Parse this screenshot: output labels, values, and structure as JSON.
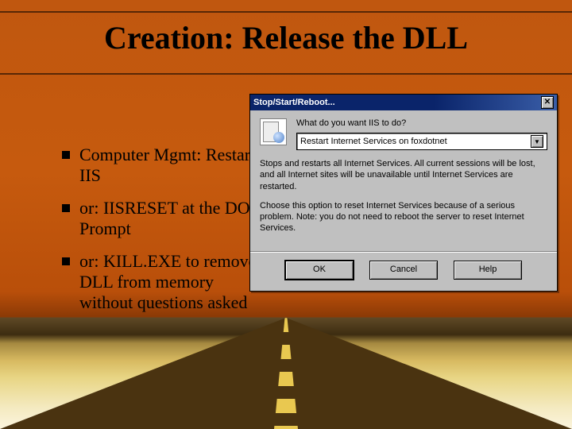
{
  "slide": {
    "title": "Creation: Release the DLL",
    "bullets": [
      "Computer Mgmt: Restart IIS",
      "or: IISRESET at the DOS-Prompt",
      "or: KILL.EXE to remove DLL from memory without questions asked"
    ]
  },
  "dialog": {
    "title": "Stop/Start/Reboot...",
    "close_glyph": "✕",
    "question": "What do you want IIS to do?",
    "combo": {
      "selected": "Restart Internet Services on foxdotnet",
      "arrow_glyph": "▼"
    },
    "description": {
      "line1": "Stops and restarts all Internet Services.  All current sessions will be lost, and all Internet sites will be unavailable until Internet Services are restarted.",
      "line2": "Choose this option to reset Internet Services because of a serious problem.  Note: you do not need to reboot the server to reset Internet Services."
    },
    "buttons": {
      "ok": "OK",
      "cancel": "Cancel",
      "help": "Help"
    }
  }
}
